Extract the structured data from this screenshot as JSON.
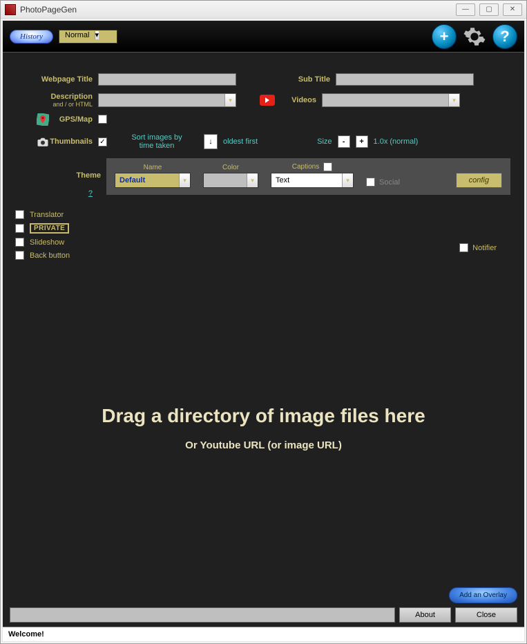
{
  "window": {
    "title": "PhotoPageGen"
  },
  "toolbar": {
    "history": "History",
    "mode": "Normal"
  },
  "form": {
    "webpage_title_label": "Webpage Title",
    "subtitle_label": "Sub Title",
    "description_label": "Description",
    "description_sub": "and / or HTML",
    "videos_label": "Videos",
    "gpsmap_label": "GPS/Map",
    "thumbnails_label": "Thumbnails",
    "sort_label": "Sort images by time taken",
    "sort_order": "oldest first",
    "size_label": "Size",
    "size_value": "1.0x (normal)"
  },
  "theme": {
    "label": "Theme",
    "name_hdr": "Name",
    "color_hdr": "Color",
    "captions_hdr": "Captions",
    "name_value": "Default",
    "captions_value": "Text",
    "social_label": "Social",
    "config": "config",
    "help": "?"
  },
  "options": {
    "translator": "Translator",
    "private": "PRIVATE",
    "slideshow": "Slideshow",
    "back": "Back button",
    "notifier": "Notifier"
  },
  "drop": {
    "main": "Drag a directory of image files here",
    "sub": "Or Youtube URL (or image URL)"
  },
  "bottom": {
    "overlay": "Add an Overlay",
    "about": "About",
    "close": "Close"
  },
  "status": "Welcome!"
}
